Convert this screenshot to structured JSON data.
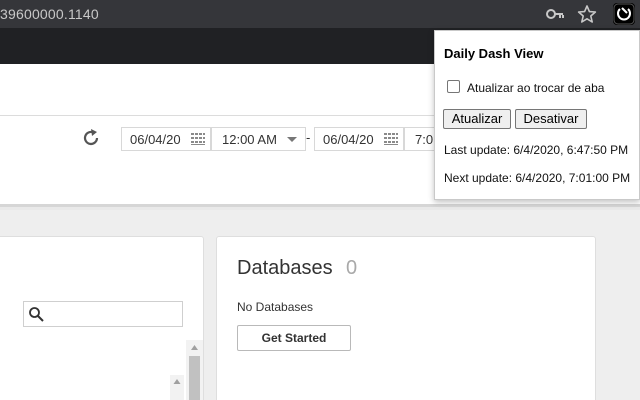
{
  "browser": {
    "url": "39600000.1140",
    "icons": [
      "key-icon",
      "star-icon",
      "extension-icon"
    ]
  },
  "toolbar": {
    "start_date": "06/04/20",
    "start_time": "12:00 AM",
    "separator": "-",
    "end_date": "06/04/20",
    "end_time": "7:0",
    "icons": [
      "refresh-icon",
      "calendar-icon",
      "chevron-down-icon"
    ]
  },
  "databases": {
    "title": "Databases",
    "count": "0",
    "empty_text": "No Databases",
    "button_label": "Get Started"
  },
  "popup": {
    "title": "Daily Dash View",
    "checkbox_label": "Atualizar ao trocar de aba",
    "checkbox_checked": false,
    "refresh_button": "Atualizar",
    "disable_button": "Desativar",
    "last_update": "Last update: 6/4/2020, 6:47:50 PM",
    "next_update": "Next update: 6/4/2020, 7:01:00 PM"
  }
}
